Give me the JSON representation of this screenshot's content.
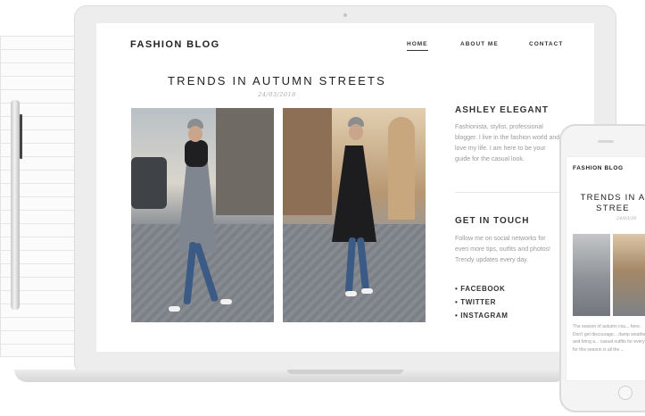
{
  "site": {
    "brand": "FASHION BLOG",
    "nav": [
      {
        "label": "HOME",
        "active": true
      },
      {
        "label": "ABOUT ME",
        "active": false
      },
      {
        "label": "CONTACT",
        "active": false
      }
    ]
  },
  "post": {
    "title": "TRENDS IN AUTUMN STREETS",
    "date": "24/03/2018"
  },
  "sidebar": {
    "about_heading": "ASHLEY ELEGANT",
    "about_text": "Fashionista, stylist, professional blogger. I live in the fashion world and love my life. I am here to be your guide for the casual look.",
    "contact_heading": "GET IN TOUCH",
    "contact_text": "Follow me on social networks for even more tips, outfits and photos! Trendy updates every day.",
    "social": [
      "FACEBOOK",
      "TWITTER",
      "INSTAGRAM"
    ]
  },
  "phone": {
    "brand": "FASHION BLOG",
    "title_line1": "TRENDS IN A",
    "title_line2": "STREE",
    "date": "24/03/20",
    "text": "The season of autumn cou... here. Don't get discourage... damp weather and bring a... casual outfits for every ... for this season is all the ..."
  },
  "colors": {
    "text_dark": "#222222",
    "text_muted": "#9a9a9a",
    "device_frame": "#ededed",
    "jeans": "#3b5a85"
  }
}
